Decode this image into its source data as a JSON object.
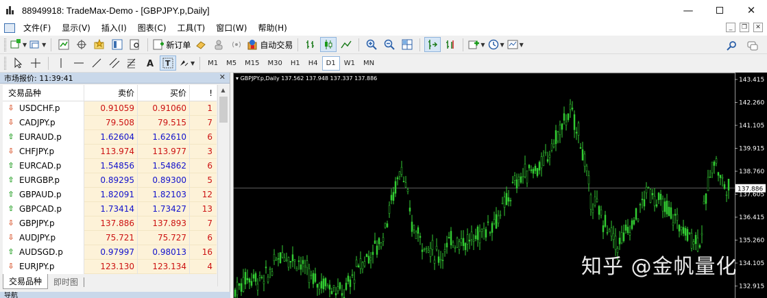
{
  "window": {
    "title": "88949918: TradeMax-Demo - [GBPJPY.p,Daily]"
  },
  "menu": [
    "文件(F)",
    "显示(V)",
    "插入(I)",
    "图表(C)",
    "工具(T)",
    "窗口(W)",
    "帮助(H)"
  ],
  "toolbar": {
    "new_order": "新订单",
    "auto_trading": "自动交易"
  },
  "timeframes": [
    "M1",
    "M5",
    "M15",
    "M30",
    "H1",
    "H4",
    "D1",
    "W1",
    "MN"
  ],
  "active_timeframe": "D1",
  "market_watch": {
    "header": "市场报价: 11:39:41",
    "columns": {
      "symbol": "交易品种",
      "bid": "卖价",
      "ask": "买价",
      "spread": "!"
    },
    "rows": [
      {
        "symbol": "USDCHF.p",
        "bid": "0.91059",
        "ask": "0.91060",
        "spread": "1",
        "dir": "down"
      },
      {
        "symbol": "CADJPY.p",
        "bid": "79.508",
        "ask": "79.515",
        "spread": "7",
        "dir": "down"
      },
      {
        "symbol": "EURAUD.p",
        "bid": "1.62604",
        "ask": "1.62610",
        "spread": "6",
        "dir": "up"
      },
      {
        "symbol": "CHFJPY.p",
        "bid": "113.974",
        "ask": "113.977",
        "spread": "3",
        "dir": "down"
      },
      {
        "symbol": "EURCAD.p",
        "bid": "1.54856",
        "ask": "1.54862",
        "spread": "6",
        "dir": "up"
      },
      {
        "symbol": "EURGBP.p",
        "bid": "0.89295",
        "ask": "0.89300",
        "spread": "5",
        "dir": "up"
      },
      {
        "symbol": "GBPAUD.p",
        "bid": "1.82091",
        "ask": "1.82103",
        "spread": "12",
        "dir": "up"
      },
      {
        "symbol": "GBPCAD.p",
        "bid": "1.73414",
        "ask": "1.73427",
        "spread": "13",
        "dir": "up"
      },
      {
        "symbol": "GBPJPY.p",
        "bid": "137.886",
        "ask": "137.893",
        "spread": "7",
        "dir": "down"
      },
      {
        "symbol": "AUDJPY.p",
        "bid": "75.721",
        "ask": "75.727",
        "spread": "6",
        "dir": "down"
      },
      {
        "symbol": "AUDSGD.p",
        "bid": "0.97997",
        "ask": "0.98013",
        "spread": "16",
        "dir": "up"
      },
      {
        "symbol": "EURJPY.p",
        "bid": "123.130",
        "ask": "123.134",
        "spread": "4",
        "dir": "down"
      }
    ],
    "tabs": [
      "交易品种",
      "即时图"
    ],
    "bottom_panel": "导航"
  },
  "chart": {
    "info": "GBPJPY.p,Daily  137.562 137.948 137.337 137.886",
    "price_labels": [
      "143.415",
      "142.260",
      "141.105",
      "139.915",
      "138.760",
      "137.605",
      "136.415",
      "135.260",
      "134.105",
      "132.915"
    ],
    "current_price": "137.886",
    "colors": {
      "background": "#000000",
      "candles": "#33cc33",
      "grid": "#ffffff"
    }
  },
  "watermark": "知乎 @金帆量化"
}
